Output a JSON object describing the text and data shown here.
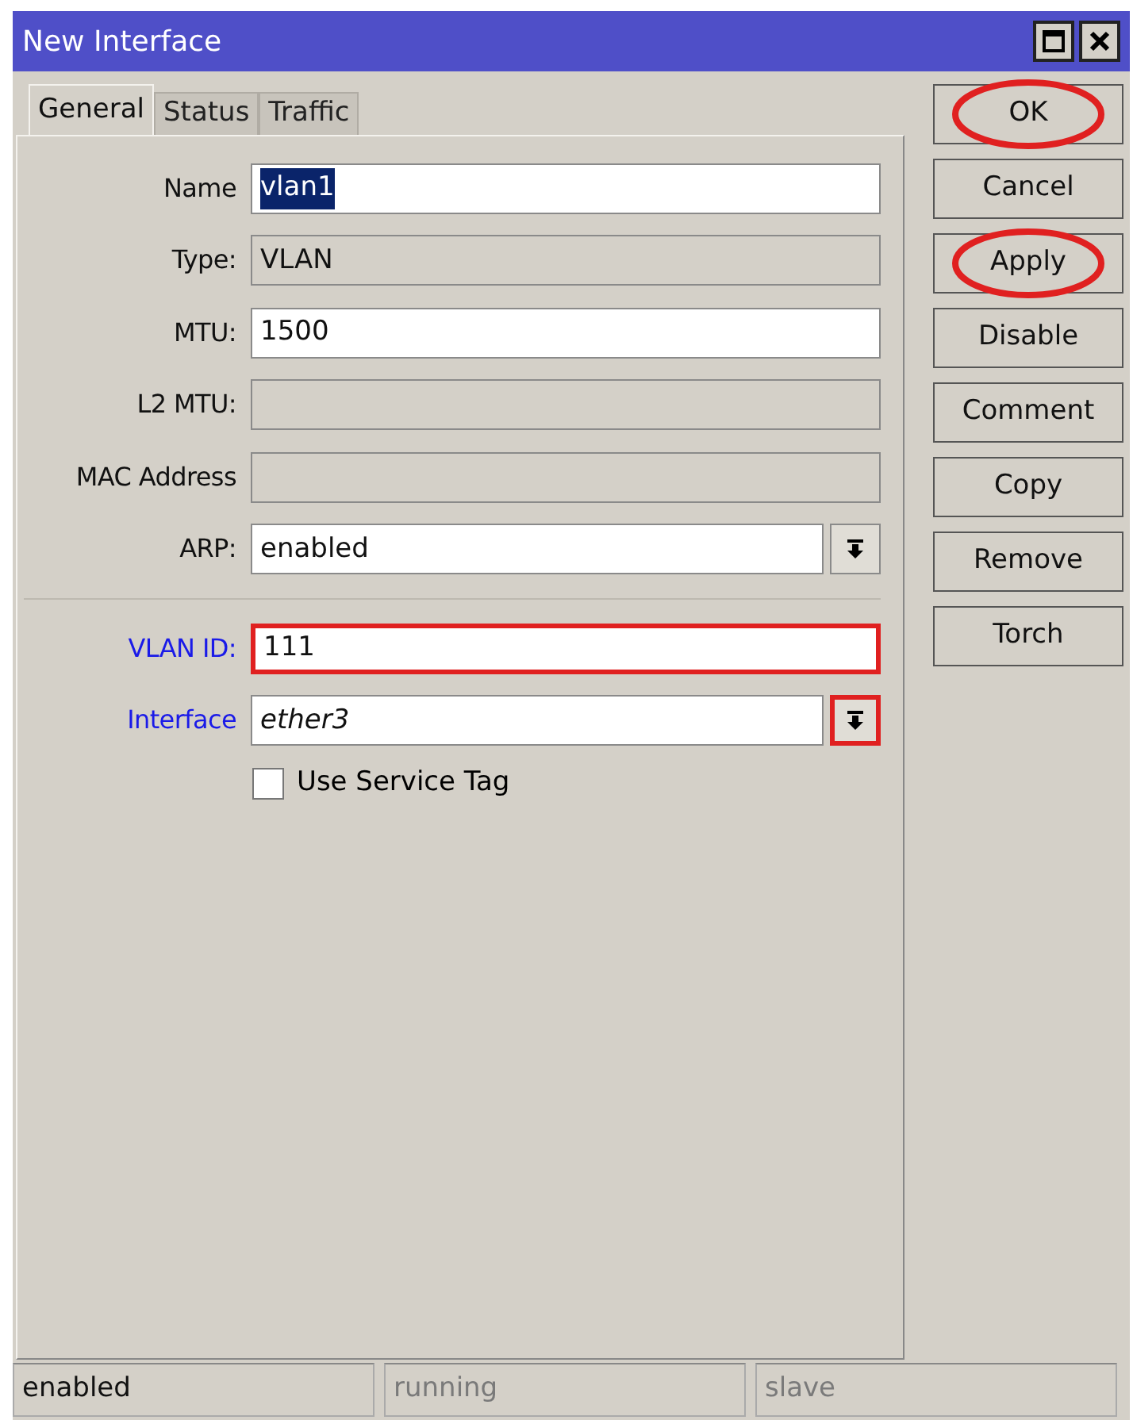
{
  "window": {
    "title": "New Interface"
  },
  "tabs": [
    {
      "label": "General",
      "selected": true
    },
    {
      "label": "Status",
      "selected": false
    },
    {
      "label": "Traffic",
      "selected": false
    }
  ],
  "fields": [
    {
      "label": "Name",
      "kind": "text",
      "value": "vlan1",
      "text_selected": true,
      "required": false,
      "highlighted": false
    },
    {
      "label": "Type:",
      "kind": "readonly",
      "value": "VLAN",
      "required": false,
      "highlighted": false
    },
    {
      "label": "MTU:",
      "kind": "text",
      "value": "1500",
      "required": false,
      "highlighted": false
    },
    {
      "label": "L2 MTU:",
      "kind": "readonly",
      "required": false,
      "highlighted": false
    },
    {
      "label": "MAC Address",
      "kind": "readonly",
      "required": false,
      "highlighted": false
    },
    {
      "label": "ARP:",
      "kind": "select",
      "value": "enabled",
      "required": false,
      "highlighted": false
    },
    {
      "kind": "separator"
    },
    {
      "label": "VLAN ID:",
      "kind": "text",
      "value": "111",
      "required": true,
      "highlighted": true
    },
    {
      "label": "Interface",
      "kind": "select",
      "value": "ether3",
      "italic": true,
      "required": true,
      "highlighted": false,
      "arrow_highlighted": true
    },
    {
      "label": "Use Service Tag",
      "kind": "checkbox",
      "checked": false
    }
  ],
  "buttons": [
    {
      "label": "OK",
      "circled": true
    },
    {
      "label": "Cancel",
      "circled": false
    },
    {
      "label": "Apply",
      "circled": true
    },
    {
      "label": "Disable",
      "circled": false
    },
    {
      "label": "Comment",
      "circled": false
    },
    {
      "label": "Copy",
      "circled": false
    },
    {
      "label": "Remove",
      "circled": false
    },
    {
      "label": "Torch",
      "circled": false
    }
  ],
  "status_bar": [
    {
      "text": "enabled",
      "disabled": false
    },
    {
      "text": "running",
      "disabled": true
    },
    {
      "text": "slave",
      "disabled": true
    }
  ]
}
